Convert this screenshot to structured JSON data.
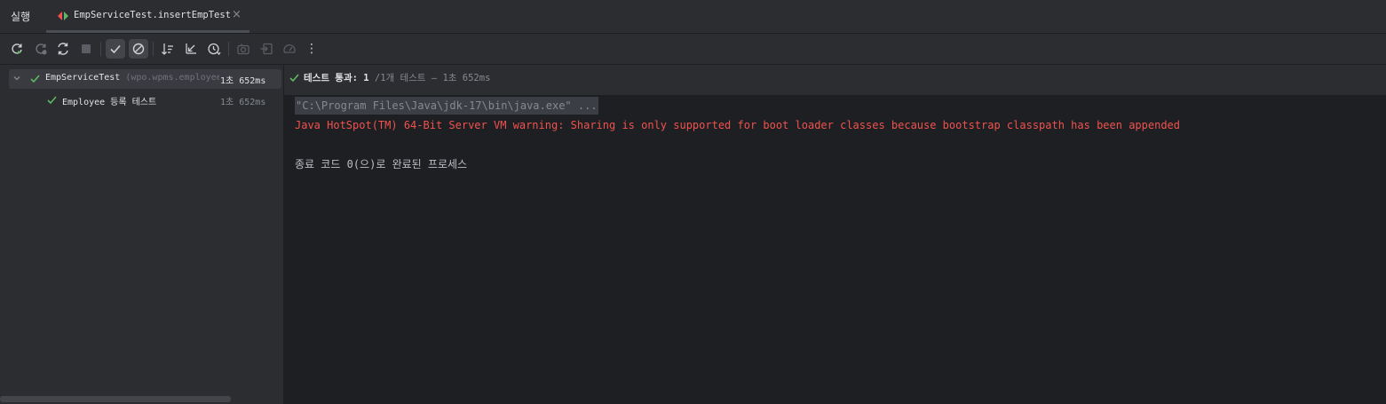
{
  "header": {
    "tool_window_title": "실행",
    "run_tab": {
      "label": "EmpServiceTest.insertEmpTest",
      "close": "×"
    }
  },
  "toolbar": {
    "buttons": [
      "rerun-icon",
      "rerun-failed-icon",
      "rerun-auto-icon",
      "stop-icon",
      "show-passed-icon",
      "show-ignored-icon",
      "sort-alpha-icon",
      "collapse-all-icon",
      "sort-duration-icon",
      "screenshot-icon",
      "import-results-icon",
      "coverage-icon",
      "more-icon"
    ],
    "more": "⋮"
  },
  "tree": {
    "root": {
      "name": "EmpServiceTest",
      "package": " (wpo.wpms.employee",
      "time": "1초 652ms"
    },
    "children": [
      {
        "name": "Employee 등록 테스트",
        "time": "1초 652ms"
      }
    ]
  },
  "status": {
    "label": "테스트 통과: 1",
    "detail": " /1개 테스트 – 1초 652ms"
  },
  "console": {
    "command": "\"C:\\Program Files\\Java\\jdk-17\\bin\\java.exe\" ...",
    "warning": "Java HotSpot(TM) 64-Bit Server VM warning: Sharing is only supported for boot loader classes because bootstrap classpath has been appended",
    "exit": "종료 코드 0(으)로 완료된 프로세스"
  },
  "colors": {
    "pass_green": "#5fb865",
    "warning_red": "#f0524f",
    "background": "#1e1f22",
    "panel": "#2b2d30"
  }
}
